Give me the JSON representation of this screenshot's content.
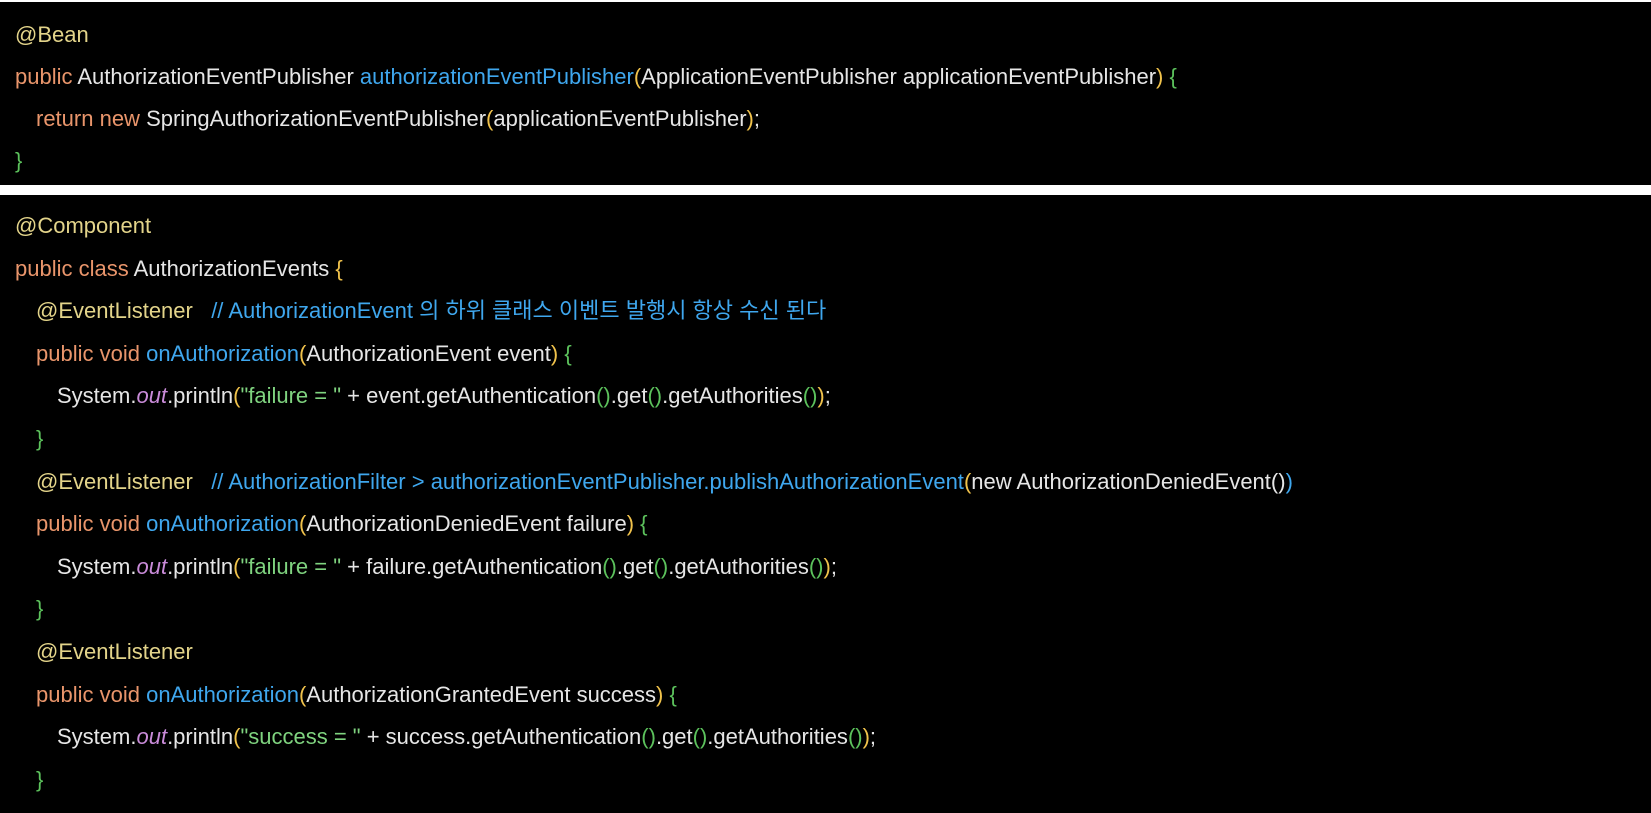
{
  "colors": {
    "background": "#000000",
    "page_background": "#ffffff",
    "default": "#e6e6e6",
    "keyword": "#e9956b",
    "annotation": "#e3d48a",
    "method": "#3fa7ee",
    "comment": "#3fa7ee",
    "paren": "#f0c24b",
    "brace_green": "#5cc25c",
    "string": "#7fd37f",
    "static_field": "#c98bd9"
  },
  "blocks": [
    {
      "name": "bean-config-snippet",
      "lines": [
        {
          "indent": 0,
          "tokens": [
            {
              "t": "@Bean",
              "c": "annotation"
            }
          ]
        },
        {
          "indent": 0,
          "tokens": [
            {
              "t": "public",
              "c": "keyword"
            },
            {
              "t": " AuthorizationEventPublisher ",
              "c": "default"
            },
            {
              "t": "authorizationEventPublisher",
              "c": "method"
            },
            {
              "t": "(",
              "c": "paren"
            },
            {
              "t": "ApplicationEventPublisher applicationEventPublisher",
              "c": "default"
            },
            {
              "t": ")",
              "c": "paren"
            },
            {
              "t": " ",
              "c": "default"
            },
            {
              "t": "{",
              "c": "brace-green"
            }
          ]
        },
        {
          "indent": 1,
          "tokens": [
            {
              "t": "return new",
              "c": "keyword"
            },
            {
              "t": " SpringAuthorizationEventPublisher",
              "c": "default"
            },
            {
              "t": "(",
              "c": "paren"
            },
            {
              "t": "applicationEventPublisher",
              "c": "default"
            },
            {
              "t": ")",
              "c": "paren"
            },
            {
              "t": ";",
              "c": "punct"
            }
          ]
        },
        {
          "indent": 0,
          "tokens": [
            {
              "t": "}",
              "c": "brace-green"
            }
          ]
        }
      ]
    },
    {
      "name": "authorization-events-snippet",
      "lines": [
        {
          "indent": 0,
          "tokens": [
            {
              "t": "@Component",
              "c": "annotation"
            }
          ]
        },
        {
          "indent": 0,
          "tokens": [
            {
              "t": "public class",
              "c": "keyword"
            },
            {
              "t": " AuthorizationEvents ",
              "c": "default"
            },
            {
              "t": "{",
              "c": "brace-outer"
            }
          ]
        },
        {
          "indent": 1,
          "tokens": [
            {
              "t": "@EventListener",
              "c": "annotation"
            },
            {
              "t": "   // AuthorizationEvent 의 하위 클래스 이벤트 발행시 항상 수신 된다",
              "c": "comment"
            }
          ]
        },
        {
          "indent": 1,
          "tokens": [
            {
              "t": "public void",
              "c": "keyword"
            },
            {
              "t": " ",
              "c": "default"
            },
            {
              "t": "onAuthorization",
              "c": "method"
            },
            {
              "t": "(",
              "c": "paren"
            },
            {
              "t": "AuthorizationEvent event",
              "c": "default"
            },
            {
              "t": ")",
              "c": "paren"
            },
            {
              "t": " ",
              "c": "default"
            },
            {
              "t": "{",
              "c": "brace-green"
            }
          ]
        },
        {
          "indent": 2,
          "tokens": [
            {
              "t": "System.",
              "c": "default"
            },
            {
              "t": "out",
              "c": "static"
            },
            {
              "t": ".println",
              "c": "default"
            },
            {
              "t": "(",
              "c": "paren"
            },
            {
              "t": "\"failure = \"",
              "c": "string"
            },
            {
              "t": " + event.getAuthentication",
              "c": "default"
            },
            {
              "t": "()",
              "c": "brace-green"
            },
            {
              "t": ".get",
              "c": "default"
            },
            {
              "t": "()",
              "c": "brace-green"
            },
            {
              "t": ".getAuthorities",
              "c": "default"
            },
            {
              "t": "()",
              "c": "brace-green"
            },
            {
              "t": ")",
              "c": "paren"
            },
            {
              "t": ";",
              "c": "punct"
            }
          ]
        },
        {
          "indent": 1,
          "tokens": [
            {
              "t": "}",
              "c": "brace-green"
            }
          ]
        },
        {
          "indent": 1,
          "tokens": [
            {
              "t": "@EventListener",
              "c": "annotation"
            },
            {
              "t": "   // AuthorizationFilter > authorizationEventPublisher.publishAuthorizationEvent",
              "c": "comment"
            },
            {
              "t": "(",
              "c": "paren"
            },
            {
              "t": "new AuthorizationDeniedEvent",
              "c": "default"
            },
            {
              "t": "()",
              "c": "default"
            },
            {
              "t": ")",
              "c": "comment"
            }
          ]
        },
        {
          "indent": 1,
          "tokens": [
            {
              "t": "public void",
              "c": "keyword"
            },
            {
              "t": " ",
              "c": "default"
            },
            {
              "t": "onAuthorization",
              "c": "method"
            },
            {
              "t": "(",
              "c": "paren"
            },
            {
              "t": "AuthorizationDeniedEvent failure",
              "c": "default"
            },
            {
              "t": ")",
              "c": "paren"
            },
            {
              "t": " ",
              "c": "default"
            },
            {
              "t": "{",
              "c": "brace-green"
            }
          ]
        },
        {
          "indent": 2,
          "tokens": [
            {
              "t": "System.",
              "c": "default"
            },
            {
              "t": "out",
              "c": "static"
            },
            {
              "t": ".println",
              "c": "default"
            },
            {
              "t": "(",
              "c": "paren"
            },
            {
              "t": "\"failure = \"",
              "c": "string"
            },
            {
              "t": " + failure.getAuthentication",
              "c": "default"
            },
            {
              "t": "()",
              "c": "brace-green"
            },
            {
              "t": ".get",
              "c": "default"
            },
            {
              "t": "()",
              "c": "brace-green"
            },
            {
              "t": ".getAuthorities",
              "c": "default"
            },
            {
              "t": "()",
              "c": "brace-green"
            },
            {
              "t": ")",
              "c": "paren"
            },
            {
              "t": ";",
              "c": "punct"
            }
          ]
        },
        {
          "indent": 1,
          "tokens": [
            {
              "t": "}",
              "c": "brace-green"
            }
          ]
        },
        {
          "indent": 1,
          "tokens": [
            {
              "t": "@EventListener",
              "c": "annotation"
            }
          ]
        },
        {
          "indent": 1,
          "tokens": [
            {
              "t": "public void",
              "c": "keyword"
            },
            {
              "t": " ",
              "c": "default"
            },
            {
              "t": "onAuthorization",
              "c": "method"
            },
            {
              "t": "(",
              "c": "paren"
            },
            {
              "t": "AuthorizationGrantedEvent success",
              "c": "default"
            },
            {
              "t": ")",
              "c": "paren"
            },
            {
              "t": " ",
              "c": "default"
            },
            {
              "t": "{",
              "c": "brace-green"
            }
          ]
        },
        {
          "indent": 2,
          "tokens": [
            {
              "t": "System.",
              "c": "default"
            },
            {
              "t": "out",
              "c": "static"
            },
            {
              "t": ".println",
              "c": "default"
            },
            {
              "t": "(",
              "c": "paren"
            },
            {
              "t": "\"success = \"",
              "c": "string"
            },
            {
              "t": " + success.getAuthentication",
              "c": "default"
            },
            {
              "t": "()",
              "c": "brace-green"
            },
            {
              "t": ".get",
              "c": "default"
            },
            {
              "t": "()",
              "c": "brace-green"
            },
            {
              "t": ".getAuthorities",
              "c": "default"
            },
            {
              "t": "()",
              "c": "brace-green"
            },
            {
              "t": ")",
              "c": "paren"
            },
            {
              "t": ";",
              "c": "punct"
            }
          ]
        },
        {
          "indent": 1,
          "tokens": [
            {
              "t": "}",
              "c": "brace-green"
            }
          ]
        }
      ]
    }
  ]
}
